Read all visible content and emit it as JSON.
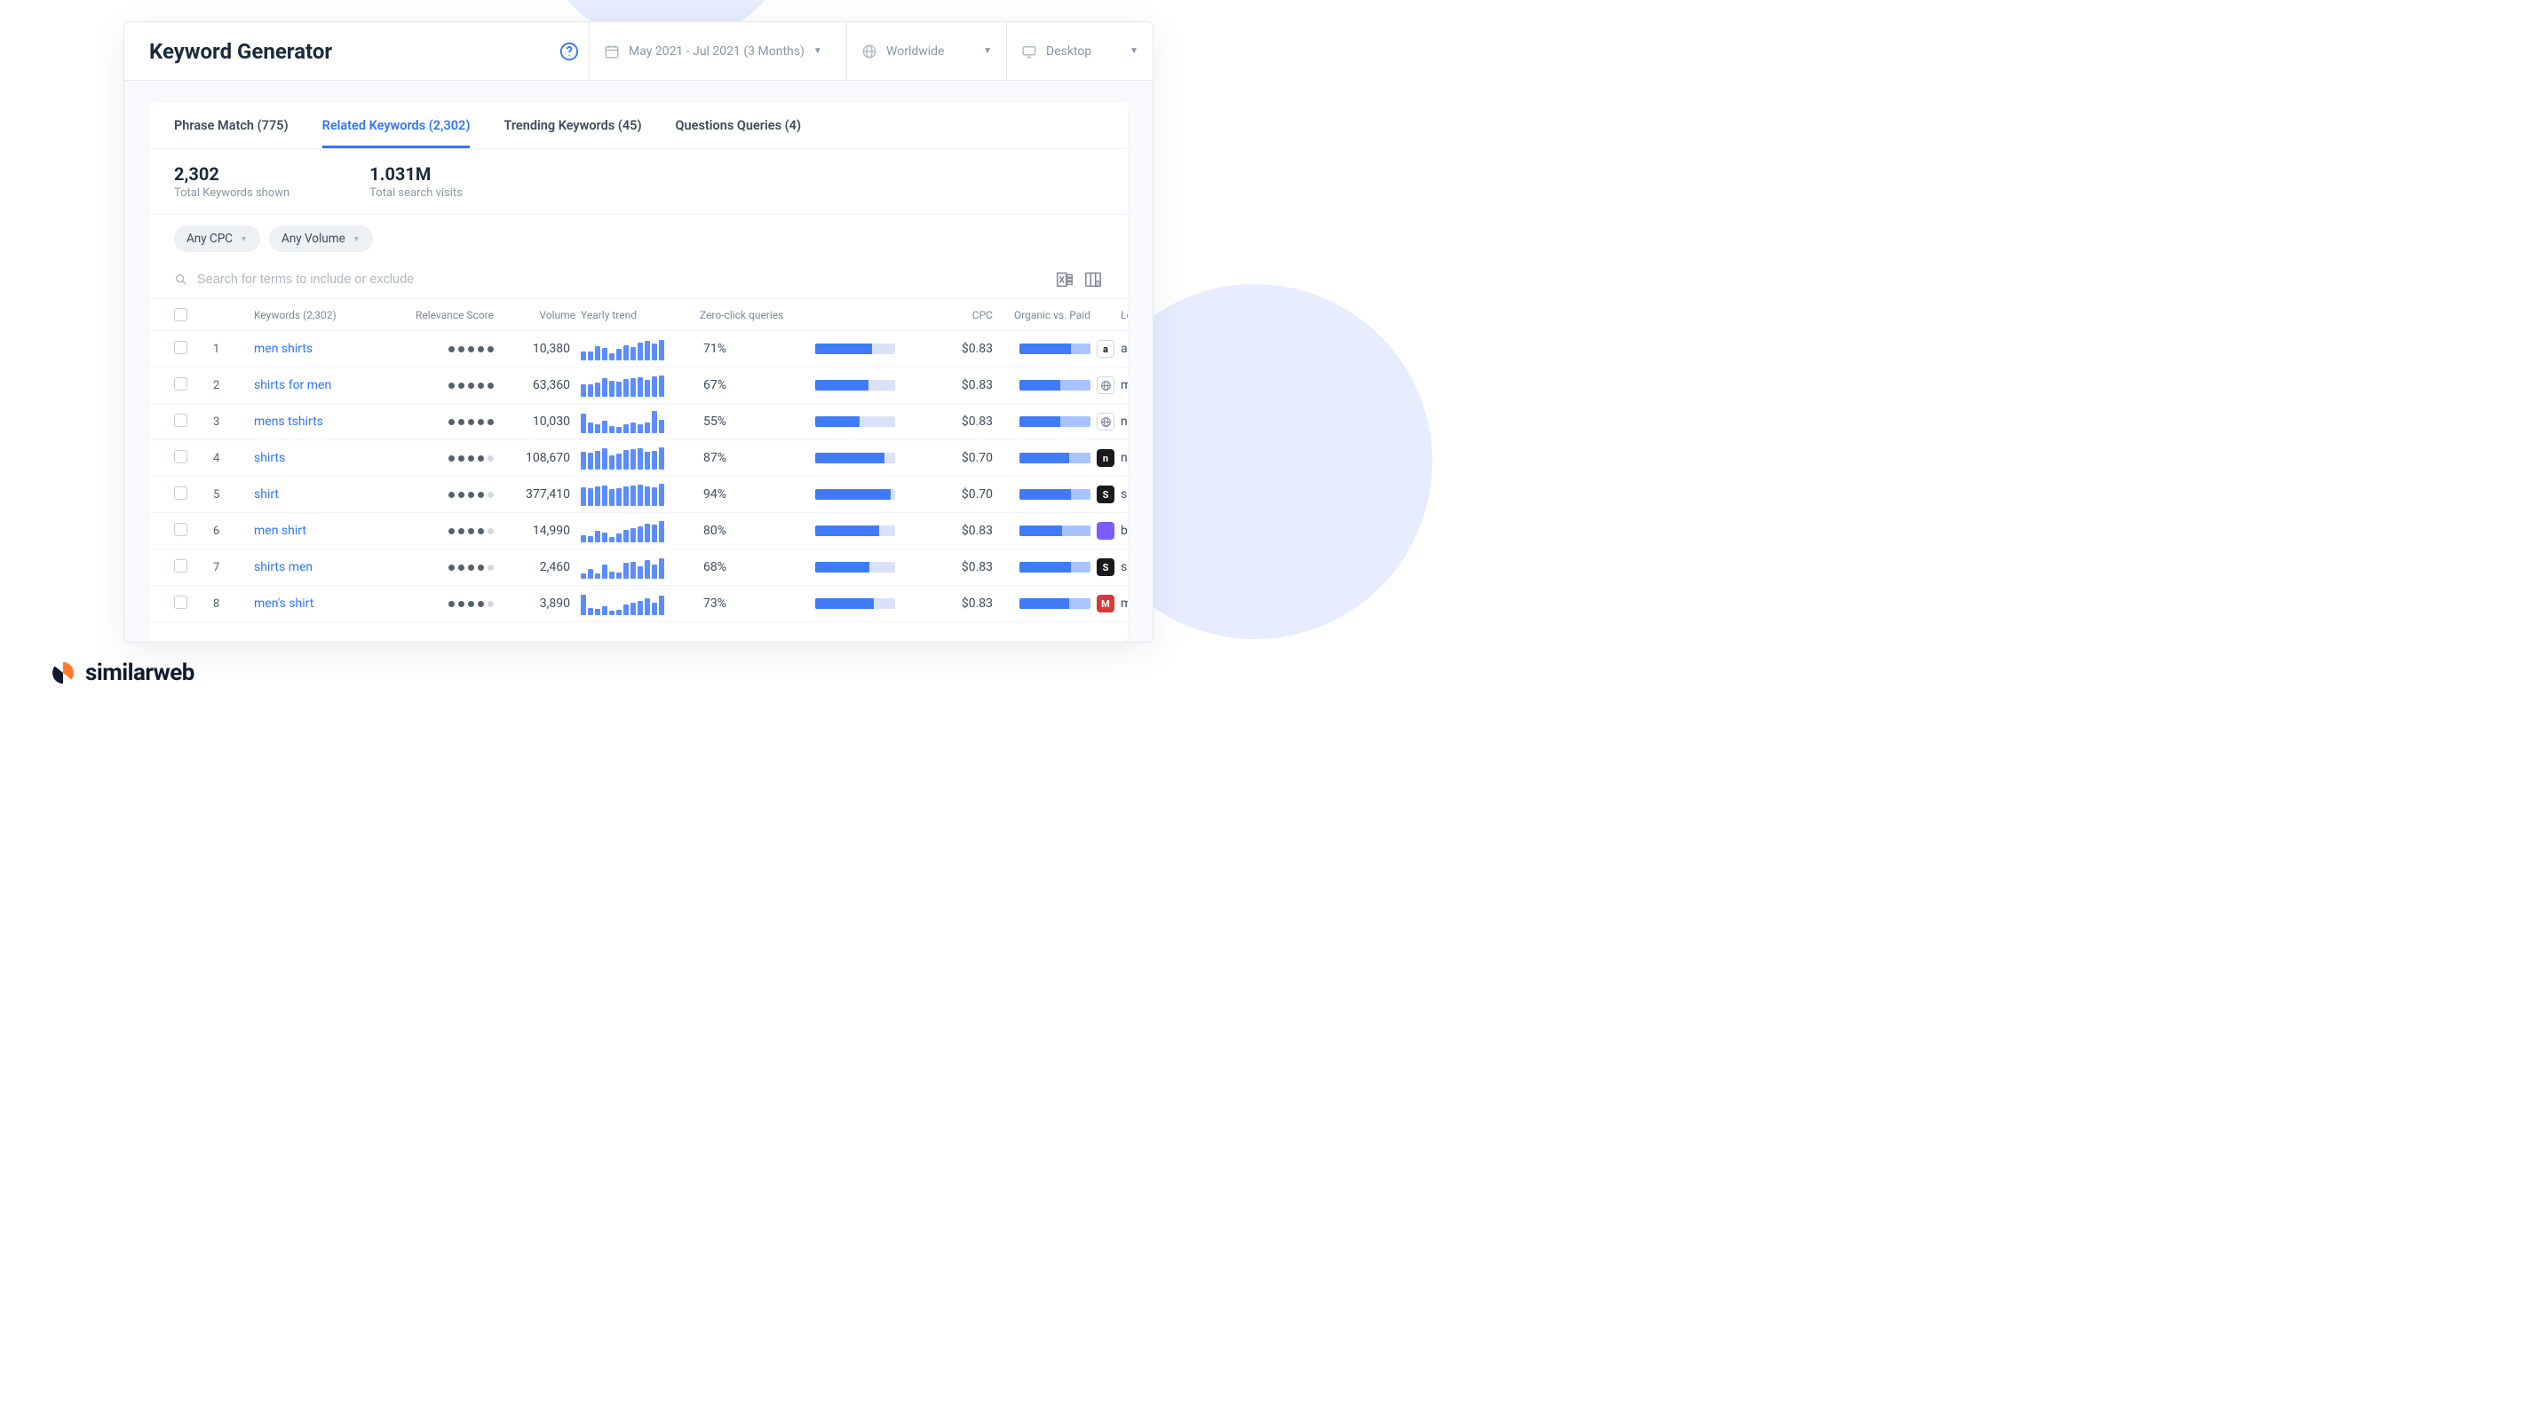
{
  "header": {
    "title": "Keyword Generator",
    "date_range": "May 2021 - Jul 2021 (3 Months)",
    "region": "Worldwide",
    "device": "Desktop"
  },
  "tabs": [
    {
      "label": "Phrase Match (775)",
      "active": false
    },
    {
      "label": "Related Keywords (2,302)",
      "active": true
    },
    {
      "label": "Trending Keywords (45)",
      "active": false
    },
    {
      "label": "Questions Queries (4)",
      "active": false
    }
  ],
  "summary": {
    "keywords_value": "2,302",
    "keywords_label": "Total Keywords shown",
    "visits_value": "1.031M",
    "visits_label": "Total search visits"
  },
  "filters": {
    "cpc": "Any CPC",
    "volume": "Any Volume"
  },
  "search": {
    "placeholder": "Search for terms to include or exclude"
  },
  "columns": {
    "keywords": "Keywords (2,302)",
    "relevance": "Relevance Score",
    "volume": "Volume",
    "trend": "Yearly trend",
    "zero_click": "Zero-click queries",
    "cpc": "CPC",
    "ovp": "Organic vs. Paid",
    "leader": "Leader"
  },
  "rows": [
    {
      "idx": "1",
      "keyword": "men shirts",
      "relevance": 5,
      "volume": "10,380",
      "trend": [
        40,
        38,
        62,
        55,
        30,
        50,
        65,
        58,
        78,
        85,
        74,
        90
      ],
      "zc": 71,
      "cpc": "$0.83",
      "ovp": 72,
      "leader": "amazon.com",
      "leader_style": "amazon",
      "leader_letter": "a"
    },
    {
      "idx": "2",
      "keyword": "shirts for men",
      "relevance": 5,
      "volume": "63,360",
      "trend": [
        55,
        52,
        60,
        80,
        68,
        65,
        78,
        82,
        86,
        72,
        88,
        94
      ],
      "zc": 67,
      "cpc": "$0.83",
      "ovp": 58,
      "leader": "myntra.com",
      "leader_style": "globe",
      "leader_letter": ""
    },
    {
      "idx": "3",
      "keyword": "mens tshirts",
      "relevance": 5,
      "volume": "10,030",
      "trend": [
        85,
        45,
        40,
        52,
        30,
        28,
        38,
        48,
        40,
        46,
        96,
        58
      ],
      "zc": 55,
      "cpc": "$0.83",
      "ovp": 57,
      "leader": "nordstrom.com",
      "leader_style": "globe",
      "leader_letter": ""
    },
    {
      "idx": "4",
      "keyword": "shirts",
      "relevance": 4,
      "volume": "108,670",
      "trend": [
        75,
        72,
        82,
        92,
        63,
        70,
        85,
        88,
        92,
        78,
        82,
        96
      ],
      "zc": 87,
      "cpc": "$0.70",
      "ovp": 70,
      "leader": "next.co.uk",
      "leader_style": "next",
      "leader_letter": "n"
    },
    {
      "idx": "5",
      "keyword": "shirt",
      "relevance": 4,
      "volume": "377,410",
      "trend": [
        80,
        76,
        84,
        90,
        74,
        78,
        86,
        90,
        94,
        84,
        80,
        96
      ],
      "zc": 94,
      "cpc": "$0.70",
      "ovp": 72,
      "leader": "shein.com",
      "leader_style": "shein",
      "leader_letter": "S"
    },
    {
      "idx": "6",
      "keyword": "men shirt",
      "relevance": 4,
      "volume": "14,990",
      "trend": [
        32,
        28,
        50,
        42,
        22,
        40,
        55,
        60,
        70,
        82,
        76,
        92
      ],
      "zc": 80,
      "cpc": "$0.83",
      "ovp": 60,
      "leader": "bulkresizephotos",
      "leader_style": "bulk",
      "leader_letter": ""
    },
    {
      "idx": "7",
      "keyword": "shirts men",
      "relevance": 4,
      "volume": "2,460",
      "trend": [
        24,
        42,
        22,
        60,
        32,
        28,
        68,
        74,
        52,
        82,
        62,
        90
      ],
      "zc": 68,
      "cpc": "$0.83",
      "ovp": 72,
      "leader": "shein.com",
      "leader_style": "shein",
      "leader_letter": "S"
    },
    {
      "idx": "8",
      "keyword": "men's shirt",
      "relevance": 4,
      "volume": "3,890",
      "trend": [
        90,
        30,
        25,
        40,
        18,
        22,
        48,
        55,
        60,
        72,
        52,
        85
      ],
      "zc": 73,
      "cpc": "$0.83",
      "ovp": 70,
      "leader": "matalan.co.uk",
      "leader_style": "matalan",
      "leader_letter": "M"
    }
  ],
  "brand": {
    "name": "similarweb"
  },
  "chart_data": {
    "type": "table",
    "note": "Each row's 'trend' is a 12-point mini bar chart (approx relative heights 0–100) and 'ovp' is % organic share.",
    "rows_ref": "See rows[] above"
  }
}
